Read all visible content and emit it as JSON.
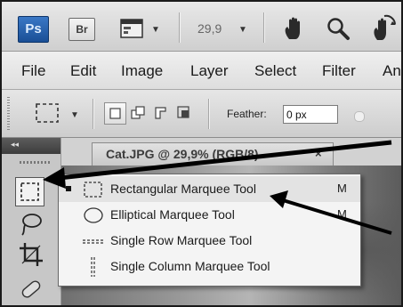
{
  "app": {
    "logo_ps": "Ps",
    "logo_br": "Br",
    "zoom": "29,9"
  },
  "menu": [
    "File",
    "Edit",
    "Image",
    "Layer",
    "Select",
    "Filter",
    "An"
  ],
  "options": {
    "feather_label": "Feather:",
    "feather_value": "0 px"
  },
  "document": {
    "tab_label": "Cat.JPG @ 29,9% (RGB/8)",
    "close": "×"
  },
  "flyout": {
    "items": [
      {
        "label": "Rectangular Marquee Tool",
        "shortcut": "M",
        "active": true
      },
      {
        "label": "Elliptical Marquee Tool",
        "shortcut": "M",
        "active": false
      },
      {
        "label": "Single Row Marquee Tool",
        "shortcut": "",
        "active": false
      },
      {
        "label": "Single Column Marquee Tool",
        "shortcut": "",
        "active": false
      }
    ]
  },
  "icons": [
    "ps-logo",
    "bridge-logo",
    "screen-mode-icon",
    "hand-icon",
    "zoom-icon",
    "rotate-view-icon",
    "rect-marquee-icon",
    "new-selection-icon",
    "add-selection-icon",
    "subtract-selection-icon",
    "intersect-selection-icon",
    "lasso-icon",
    "crop-icon",
    "healing-brush-icon",
    "brush-icon"
  ]
}
